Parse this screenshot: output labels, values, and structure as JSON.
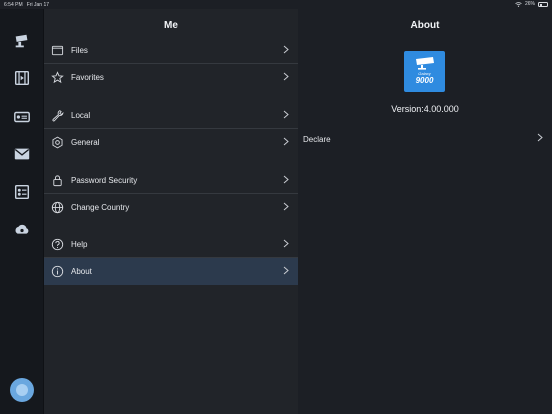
{
  "status": {
    "time": "6:54 PM",
    "date": "Fri Jan 17",
    "battery": "26%",
    "battery_level": 0.26
  },
  "rail": {
    "icons": [
      "camera-icon",
      "film-icon",
      "dvr-icon",
      "mail-icon",
      "device-list-icon",
      "cloud-icon"
    ]
  },
  "me_panel": {
    "title": "Me",
    "items": [
      {
        "label": "Files",
        "icon": "folder-icon"
      },
      {
        "label": "Favorites",
        "icon": "star-icon"
      },
      {
        "label": "Local",
        "icon": "wrench-icon"
      },
      {
        "label": "General",
        "icon": "gear-icon"
      },
      {
        "label": "Password Security",
        "icon": "lock-icon"
      },
      {
        "label": "Change Country",
        "icon": "globe-icon"
      },
      {
        "label": "Help",
        "icon": "help-icon"
      },
      {
        "label": "About",
        "icon": "info-icon",
        "selected": true
      }
    ]
  },
  "about_panel": {
    "title": "About",
    "logo_text_top": "Galaxy",
    "logo_text_num": "9000",
    "version": "Version:4.00.000",
    "declare_label": "Declare"
  },
  "colors": {
    "accent": "#2f8be0",
    "selected_row": "#2c3a4d",
    "avatar": "#6aa7df"
  }
}
